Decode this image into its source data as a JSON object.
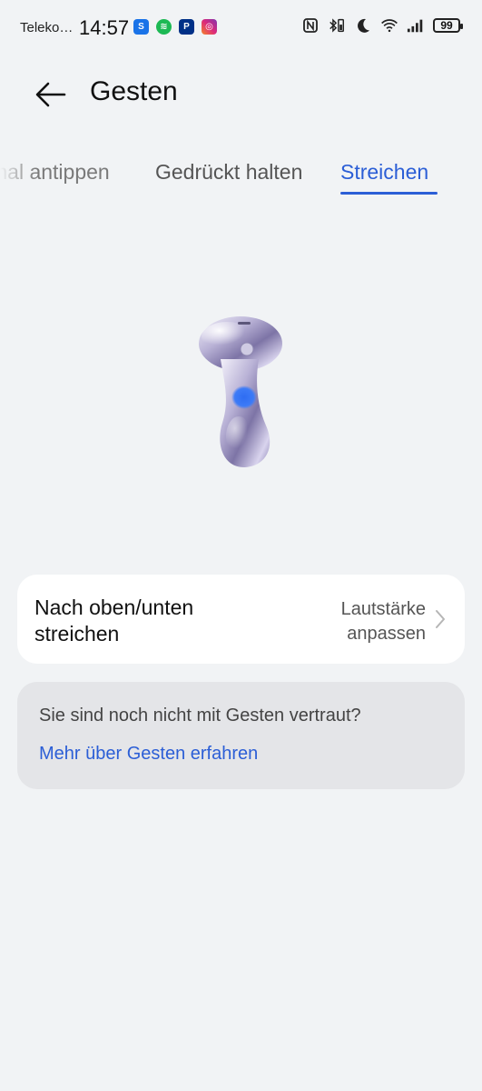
{
  "status_bar": {
    "carrier": "Teleko…",
    "time": "14:57",
    "battery": "99",
    "app_icons": [
      "shazam-like-icon",
      "spotify-icon",
      "paypal-icon",
      "instagram-icon"
    ],
    "system_icons": [
      "nfc-icon",
      "bluetooth-battery-icon",
      "do-not-disturb-moon-icon",
      "wifi-icon",
      "signal-icon"
    ]
  },
  "header": {
    "title": "Gesten",
    "back_icon": "arrow-left-icon"
  },
  "tabs": {
    "items": [
      "mal antippen",
      "Gedrückt halten",
      "Streichen"
    ],
    "active_index": 2,
    "accent_color": "#2b5ed6"
  },
  "gesture_setting": {
    "label": "Nach oben/unten streichen",
    "value": "Lautstärke anpassen"
  },
  "hint": {
    "text": "Sie sind noch nicht mit Gesten vertraut?",
    "link": "Mehr über Gesten erfahren"
  }
}
